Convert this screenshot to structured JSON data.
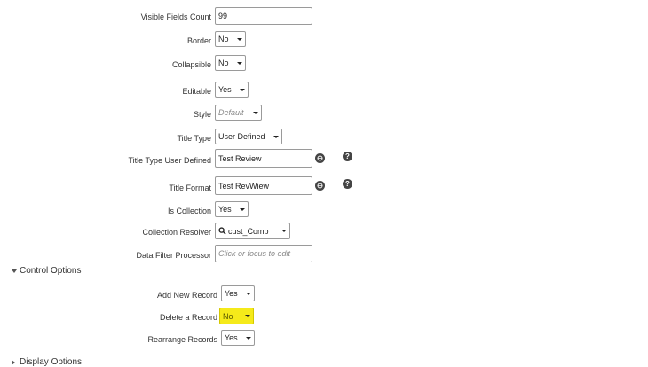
{
  "fields": {
    "visible_fields_count": {
      "label": "Visible Fields Count",
      "value": "99"
    },
    "border": {
      "label": "Border",
      "value": "No"
    },
    "collapsible": {
      "label": "Collapsible",
      "value": "No"
    },
    "editable": {
      "label": "Editable",
      "value": "Yes"
    },
    "style": {
      "label": "Style",
      "value": "Default"
    },
    "title_type": {
      "label": "Title Type",
      "value": "User Defined"
    },
    "title_type_user_defined": {
      "label": "Title Type User Defined",
      "value": "Test Review"
    },
    "title_format": {
      "label": "Title Format",
      "value": "Test RevWiew"
    },
    "is_collection": {
      "label": "Is Collection",
      "value": "Yes"
    },
    "collection_resolver": {
      "label": "Collection Resolver",
      "value": "cust_Comp"
    },
    "data_filter_processor": {
      "label": "Data Filter Processor",
      "placeholder": "Click or focus to edit"
    }
  },
  "control_options": {
    "title": "Control Options",
    "add_new_record": {
      "label": "Add New Record",
      "value": "Yes"
    },
    "delete_a_record": {
      "label": "Delete a Record",
      "value": "No",
      "highlight_color": "#f5ea1a"
    },
    "rearrange_records": {
      "label": "Rearrange Records",
      "value": "Yes"
    }
  },
  "display_options": {
    "title": "Display Options"
  },
  "icons": {
    "translate": "globe-icon",
    "help": "help-icon",
    "search": "search-icon"
  }
}
